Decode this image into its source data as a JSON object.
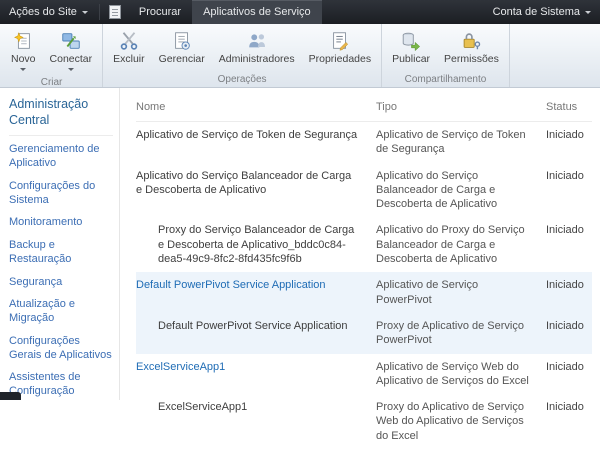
{
  "topbar": {
    "site_actions_label": "Ações do Site",
    "account_label": "Conta de Sistema",
    "tabs": [
      {
        "label": "Procurar",
        "active": false
      },
      {
        "label": "Aplicativos de Serviço",
        "active": true
      }
    ]
  },
  "ribbon": {
    "groups": [
      {
        "label": "Criar",
        "buttons": [
          {
            "label": "Novo",
            "icon": "new-item-icon",
            "dropdown": true
          },
          {
            "label": "Conectar",
            "icon": "connect-icon",
            "dropdown": true
          }
        ]
      },
      {
        "label": "Operações",
        "buttons": [
          {
            "label": "Excluir",
            "icon": "delete-scissors-icon"
          },
          {
            "label": "Gerenciar",
            "icon": "manage-document-icon"
          },
          {
            "label": "Administradores",
            "icon": "administrators-people-icon"
          },
          {
            "label": "Propriedades",
            "icon": "properties-document-icon"
          }
        ]
      },
      {
        "label": "Compartilhamento",
        "buttons": [
          {
            "label": "Publicar",
            "icon": "publish-arrow-icon"
          },
          {
            "label": "Permissões",
            "icon": "permissions-lock-icon"
          }
        ]
      }
    ]
  },
  "sidebar": {
    "title": "Administração Central",
    "items": [
      "Gerenciamento de Aplicativo",
      "Configurações do Sistema",
      "Monitoramento",
      "Backup e Restauração",
      "Segurança",
      "Atualização e Migração",
      "Configurações Gerais de Aplicativos",
      "Assistentes de Configuração"
    ]
  },
  "table": {
    "columns": {
      "name": "Nome",
      "type": "Tipo",
      "status": "Status"
    },
    "rows": [
      {
        "name": "Aplicativo de Serviço de Token de Segurança",
        "type": "Aplicativo de Serviço de Token de Segurança",
        "status": "Iniciado",
        "link": false,
        "indent": false,
        "highlight": false
      },
      {
        "name": "Aplicativo do Serviço Balanceador de Carga e Descoberta de Aplicativo",
        "type": "Aplicativo do Serviço Balanceador de Carga e Descoberta de Aplicativo",
        "status": "Iniciado",
        "link": false,
        "indent": false,
        "highlight": false
      },
      {
        "name": "Proxy do Serviço Balanceador de Carga e Descoberta de Aplicativo_bddc0c84-dea5-49c9-8fc2-8fd435fc9f6b",
        "type": "Aplicativo do Proxy do Serviço Balanceador de Carga e Descoberta de Aplicativo",
        "status": "Iniciado",
        "link": false,
        "indent": true,
        "highlight": false
      },
      {
        "name": "Default PowerPivot Service Application",
        "type": "Aplicativo de Serviço PowerPivot",
        "status": "Iniciado",
        "link": true,
        "indent": false,
        "highlight": true
      },
      {
        "name": "Default PowerPivot Service Application",
        "type": "Proxy de Aplicativo de Serviço PowerPivot",
        "status": "Iniciado",
        "link": false,
        "indent": true,
        "highlight": true
      },
      {
        "name": "ExcelServiceApp1",
        "type": "Aplicativo de Serviço Web do Aplicativo de Serviços do Excel",
        "status": "Iniciado",
        "link": true,
        "indent": false,
        "highlight": false
      },
      {
        "name": "ExcelServiceApp1",
        "type": "Proxy do Aplicativo de Serviço Web do Aplicativo de Serviços do Excel",
        "status": "Iniciado",
        "link": false,
        "indent": true,
        "highlight": false
      }
    ]
  },
  "colors": {
    "topbar_bg": "#1b1e23",
    "active_tab_bg": "#3f444c",
    "ribbon_bg": "#eaeff4",
    "nav_link_blue": "#3c6eb4",
    "item_link_blue": "#1f6cb5",
    "highlight_row": "#edf4fb"
  }
}
